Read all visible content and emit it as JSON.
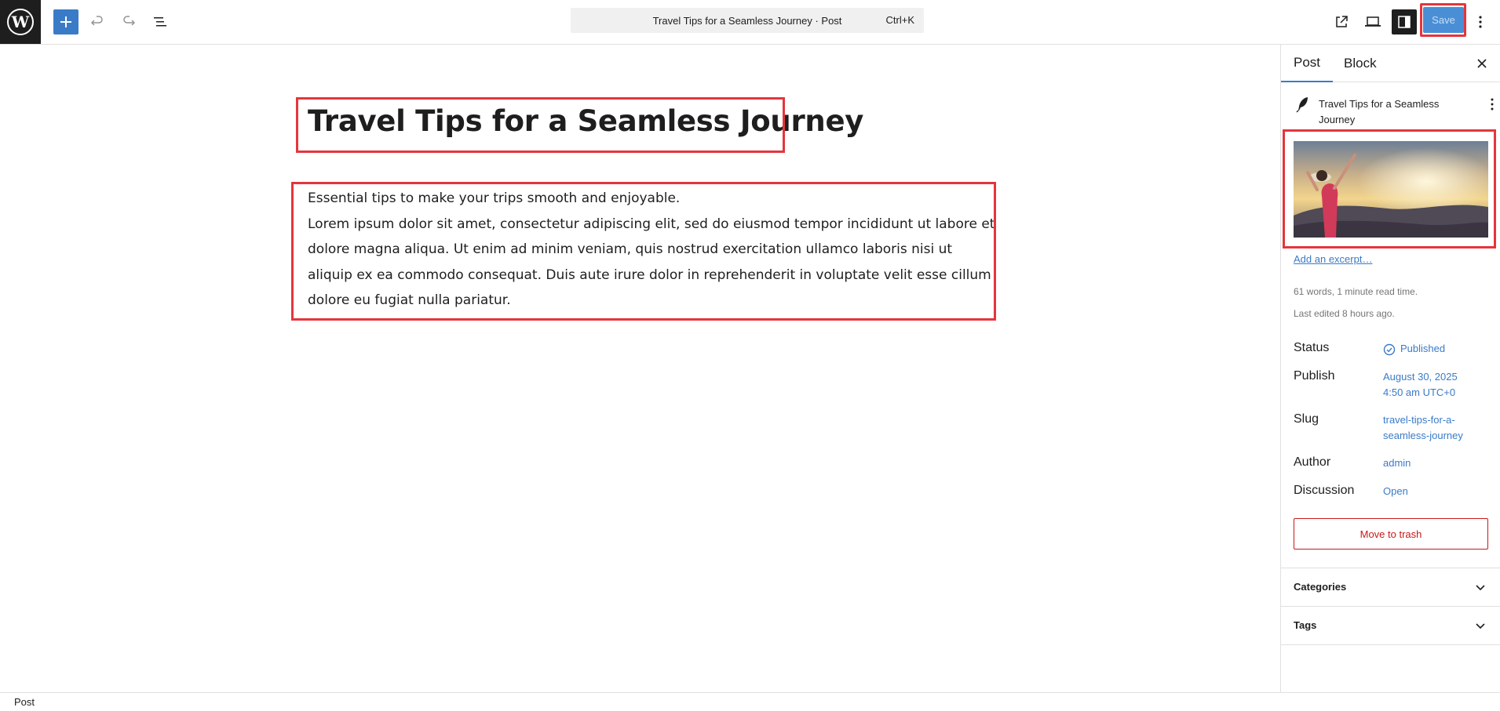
{
  "topbar": {
    "logo_icon": "wordpress-logo-icon",
    "add_icon": "plus-icon",
    "undo_icon": "undo-icon",
    "redo_icon": "redo-icon",
    "list_view_icon": "list-view-icon",
    "command_title": "Travel Tips for a Seamless Journey · Post",
    "command_shortcut": "Ctrl+K",
    "view_icon": "external-link-icon",
    "preview_icon": "desktop-preview-icon",
    "settings_icon": "sidebar-settings-icon",
    "save_label": "Save",
    "more_icon": "vertical-ellipsis-icon"
  },
  "editor": {
    "title": "Travel Tips for a Seamless Journey",
    "paragraph_intro": "Essential tips to make your trips smooth and enjoyable.",
    "paragraph_body": "Lorem ipsum dolor sit amet, consectetur adipiscing elit, sed do eiusmod tempor incididunt ut labore et dolore magna aliqua. Ut enim ad minim veniam, quis nostrud exercitation ullamco laboris nisi ut aliquip ex ea commodo consequat. Duis aute irure dolor in reprehenderit in voluptate velit esse cillum dolore eu fugiat nulla pariatur."
  },
  "sidebar": {
    "tabs": [
      {
        "label": "Post",
        "active": true
      },
      {
        "label": "Block",
        "active": false
      }
    ],
    "summary": {
      "title": "Travel Tips for a Seamless Journey"
    },
    "excerpt_link": "Add an excerpt…",
    "word_count": "61 words, 1 minute read time.",
    "last_edited": "Last edited 8 hours ago.",
    "rows": {
      "status": {
        "label": "Status",
        "value": "Published"
      },
      "publish": {
        "label": "Publish",
        "value_date": "August 30, 2025",
        "value_time": "4:50 am UTC+0"
      },
      "slug": {
        "label": "Slug",
        "value_line1": "travel-tips-for-a-",
        "value_line2": "seamless-journey"
      },
      "author": {
        "label": "Author",
        "value": "admin"
      },
      "discussion": {
        "label": "Discussion",
        "value": "Open"
      }
    },
    "trash_label": "Move to trash",
    "panels": [
      {
        "label": "Categories"
      },
      {
        "label": "Tags"
      }
    ]
  },
  "footer": {
    "breadcrumb": "Post"
  },
  "colors": {
    "accent": "#3a7bc8",
    "highlight_outline": "#e5353d",
    "danger": "#cc1818"
  }
}
